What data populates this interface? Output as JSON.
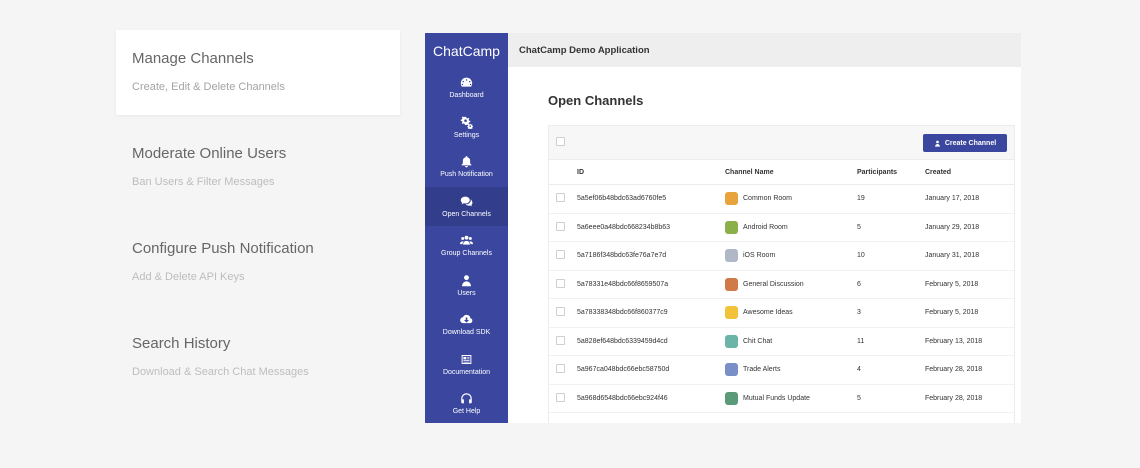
{
  "features": [
    {
      "title": "Manage Channels",
      "subtitle": "Create, Edit & Delete Channels",
      "active": true
    },
    {
      "title": "Moderate Online Users",
      "subtitle": "Ban Users & Filter Messages",
      "active": false
    },
    {
      "title": "Configure Push Notification",
      "subtitle": "Add & Delete API Keys",
      "active": false
    },
    {
      "title": "Search History",
      "subtitle": "Download & Search Chat Messages",
      "active": false
    }
  ],
  "app": {
    "brand": "ChatCamp",
    "title": "ChatCamp Demo Application",
    "nav": [
      {
        "label": "Dashboard",
        "icon": "dashboard-icon"
      },
      {
        "label": "Settings",
        "icon": "gears-icon"
      },
      {
        "label": "Push Notification",
        "icon": "bell-icon"
      },
      {
        "label": "Open Channels",
        "icon": "comments-icon",
        "active": true
      },
      {
        "label": "Group Channels",
        "icon": "users-icon"
      },
      {
        "label": "Users",
        "icon": "user-icon"
      },
      {
        "label": "Download SDK",
        "icon": "cloud-download-icon"
      },
      {
        "label": "Documentation",
        "icon": "newspaper-icon"
      },
      {
        "label": "Get Help",
        "icon": "headphones-icon"
      }
    ]
  },
  "page": {
    "title": "Open Channels",
    "create_button": "Create Channel"
  },
  "table": {
    "columns": [
      "ID",
      "Channel Name",
      "Participants",
      "Created"
    ],
    "rows": [
      {
        "id": "5a5ef06b48bdc63ad6760fe5",
        "name": "Common Room",
        "participants": "19",
        "created": "January 17, 2018",
        "avatar_color": "#e8a33d"
      },
      {
        "id": "5a6eee0a48bdc668234b8b63",
        "name": "Android Room",
        "participants": "5",
        "created": "January 29, 2018",
        "avatar_color": "#8bb04a"
      },
      {
        "id": "5a7186f348bdc63fe76a7e7d",
        "name": "iOS Room",
        "participants": "10",
        "created": "January 31, 2018",
        "avatar_color": "#b0b8c8"
      },
      {
        "id": "5a78331e48bdc66f8659507a",
        "name": "General Discussion",
        "participants": "6",
        "created": "February 5, 2018",
        "avatar_color": "#d07a4a"
      },
      {
        "id": "5a78338348bdc66f860377c9",
        "name": "Awesome Ideas",
        "participants": "3",
        "created": "February 5, 2018",
        "avatar_color": "#f2c23a"
      },
      {
        "id": "5a828ef648bdc6339459d4cd",
        "name": "Chit Chat",
        "participants": "11",
        "created": "February 13, 2018",
        "avatar_color": "#6bb5a8"
      },
      {
        "id": "5a967ca048bdc66ebc58750d",
        "name": "Trade Alerts",
        "participants": "4",
        "created": "February 28, 2018",
        "avatar_color": "#7a8fc7"
      },
      {
        "id": "5a968d6548bdc66ebc924f46",
        "name": "Mutual Funds Update",
        "participants": "5",
        "created": "February 28, 2018",
        "avatar_color": "#5a9a78"
      }
    ]
  }
}
